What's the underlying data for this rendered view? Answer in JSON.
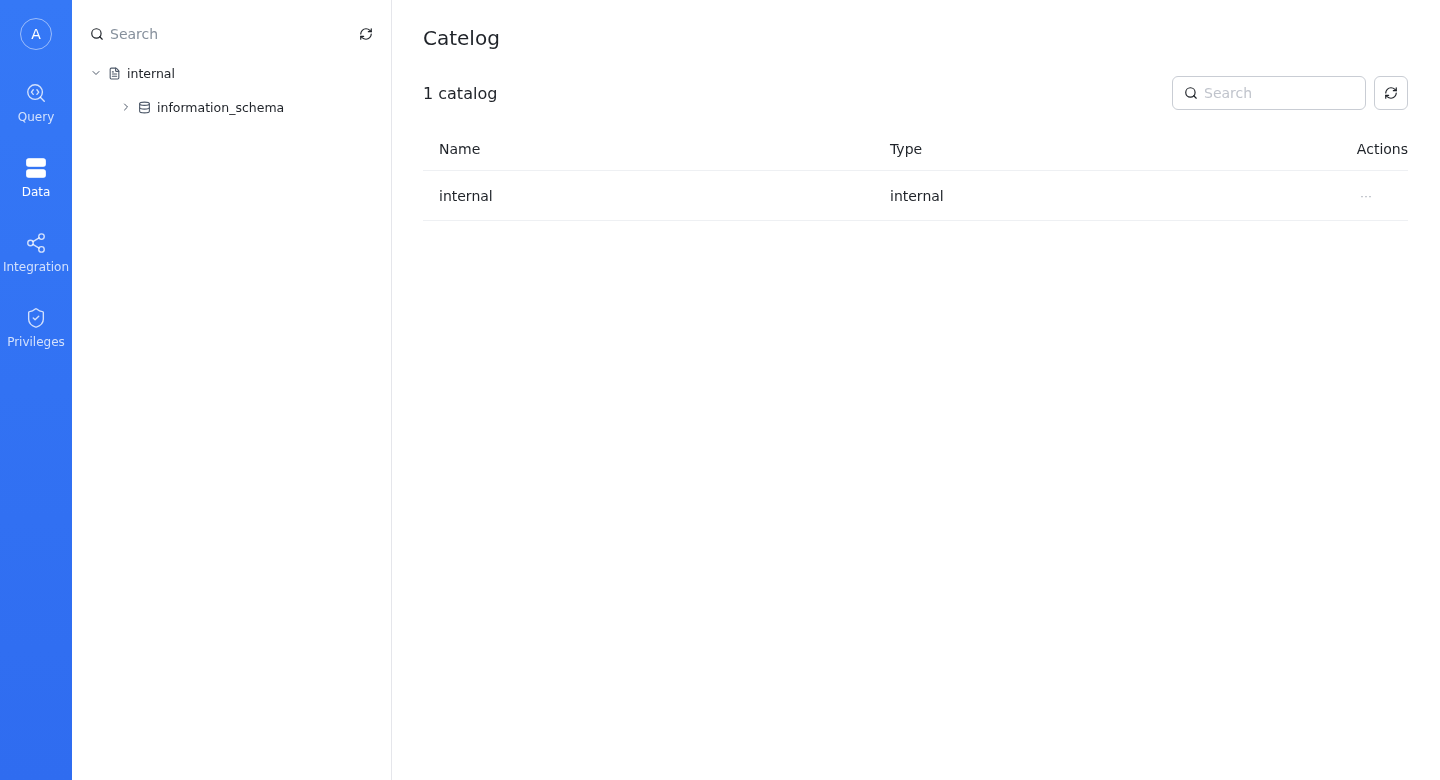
{
  "nav": {
    "avatar": "A",
    "items": [
      {
        "kind": "query",
        "label": "Query",
        "selected": false
      },
      {
        "kind": "data",
        "label": "Data",
        "selected": true
      },
      {
        "kind": "integration",
        "label": "Integration",
        "selected": false
      },
      {
        "kind": "privileges",
        "label": "Privileges",
        "selected": false
      }
    ]
  },
  "tree": {
    "search": {
      "placeholder": "Search"
    },
    "items": [
      {
        "kind": "catalog",
        "label": "internal",
        "expanded": true,
        "children": [
          {
            "kind": "database",
            "label": "information_schema",
            "expanded": false
          }
        ]
      }
    ]
  },
  "main": {
    "title": "Catelog",
    "count": "1 catalog",
    "search": {
      "placeholder": "Search"
    },
    "table": {
      "columns": [
        "Name",
        "Type",
        "Actions"
      ],
      "rows": [
        {
          "name": "internal",
          "type": "internal",
          "actions": "···"
        }
      ]
    }
  }
}
